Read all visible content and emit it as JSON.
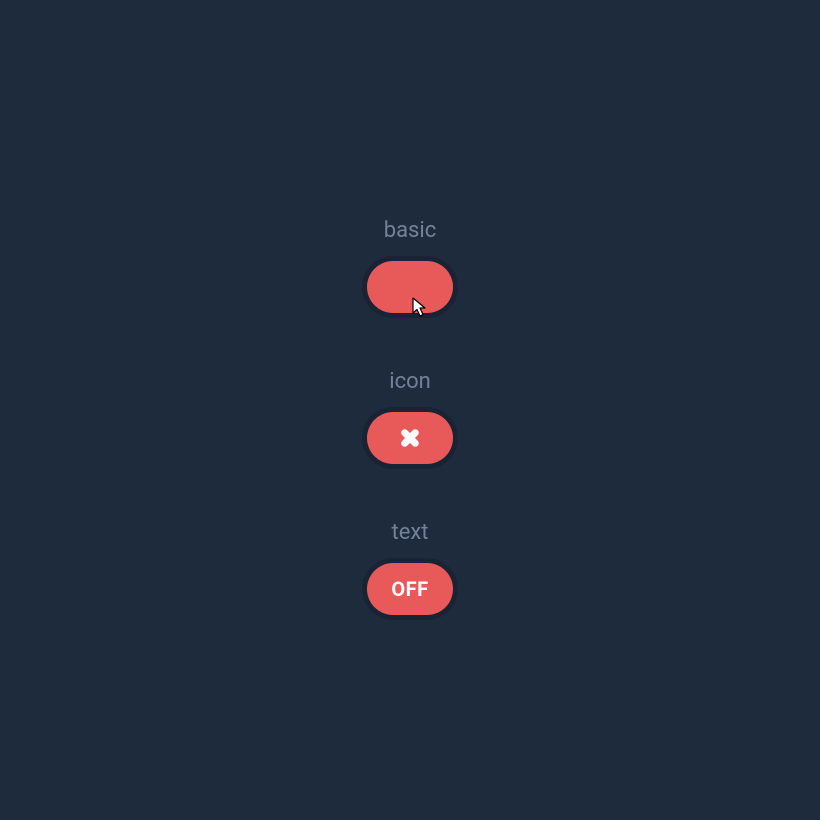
{
  "toggles": {
    "basic": {
      "label": "basic"
    },
    "icon": {
      "label": "icon"
    },
    "text": {
      "label": "text",
      "value": "OFF"
    }
  },
  "colors": {
    "background": "#1e2b3c",
    "pill": "#e85a5a",
    "pill_ring": "#182334",
    "label": "#73829a"
  }
}
